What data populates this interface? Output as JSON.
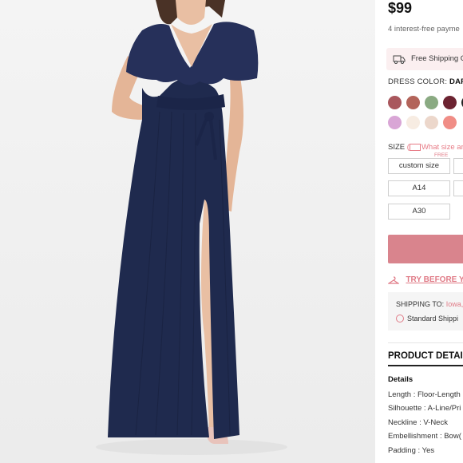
{
  "product": {
    "price": "$99",
    "installments": "4 interest-free payme"
  },
  "shipping_banner": {
    "label": "Free Shipping O",
    "icon": "truck-icon"
  },
  "color": {
    "label": "DRESS COLOR:",
    "value": "DARK",
    "swatches": [
      "#a9575d",
      "#b3645a",
      "#8aaa82",
      "#6c2331",
      "#222222",
      "#d9a6d6",
      "#f7ece2",
      "#ecd7cb",
      "#f08d86"
    ]
  },
  "size": {
    "label": "SIZE",
    "guide_link": "What size ar",
    "free_badge": "FREE",
    "options": [
      "custom size",
      "A14",
      "A30"
    ]
  },
  "try_before": {
    "label": "TRY BEFORE YO"
  },
  "shipping": {
    "to_label": "SHIPPING TO:",
    "location": "Iowa,",
    "standard": "Standard Shippi"
  },
  "product_details": {
    "title": "PRODUCT DETAIL",
    "section": "Details",
    "rows": [
      "Length : Floor-Length",
      "Silhouette : A-Line/Pri",
      "Neckline : V-Neck",
      "Embellishment : Bow(",
      "Padding : Yes"
    ]
  },
  "colors": {
    "accent": "#e07b87",
    "button": "#d9848d",
    "dress": "#1f2a4e"
  }
}
